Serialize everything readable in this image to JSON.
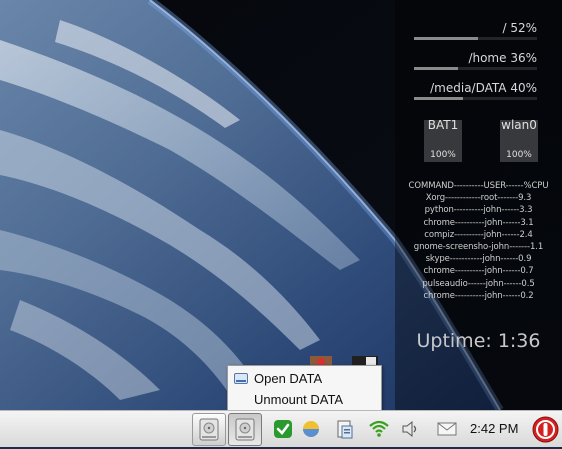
{
  "conky": {
    "disks": [
      {
        "label": "/ 52%",
        "percent": 52
      },
      {
        "label": "/home 36%",
        "percent": 36
      },
      {
        "label": "/media/DATA 40%",
        "percent": 40
      }
    ],
    "meters": [
      {
        "name": "BAT1",
        "value": "100%"
      },
      {
        "name": "wlan0",
        "value": "100%"
      }
    ],
    "process_header": "COMMAND----------USER------%CPU",
    "processes": [
      "Xorg------------root-------9.3",
      "python----------john------3.3",
      "chrome----------john------3.1",
      "compiz----------john------2.4",
      "gnome-screensho-john-------1.1",
      "skype-----------john------0.9",
      "chrome----------john------0.7",
      "pulseaudio------john------0.5",
      "chrome----------john------0.2"
    ],
    "uptime": "Uptime: 1:36"
  },
  "context_menu": {
    "items": [
      {
        "label": "Open DATA",
        "icon": "drive-icon"
      },
      {
        "label": "Unmount DATA"
      }
    ]
  },
  "taskbar": {
    "clock": "2:42 PM",
    "tray_icons": [
      "checkmark-icon",
      "weather-icon",
      "clipboard-icon",
      "wifi-icon",
      "volume-icon",
      "mail-icon",
      "power-icon"
    ],
    "colors": {
      "power": "#d42020",
      "wifi": "#3aa020",
      "check": "#2a9a30"
    }
  }
}
